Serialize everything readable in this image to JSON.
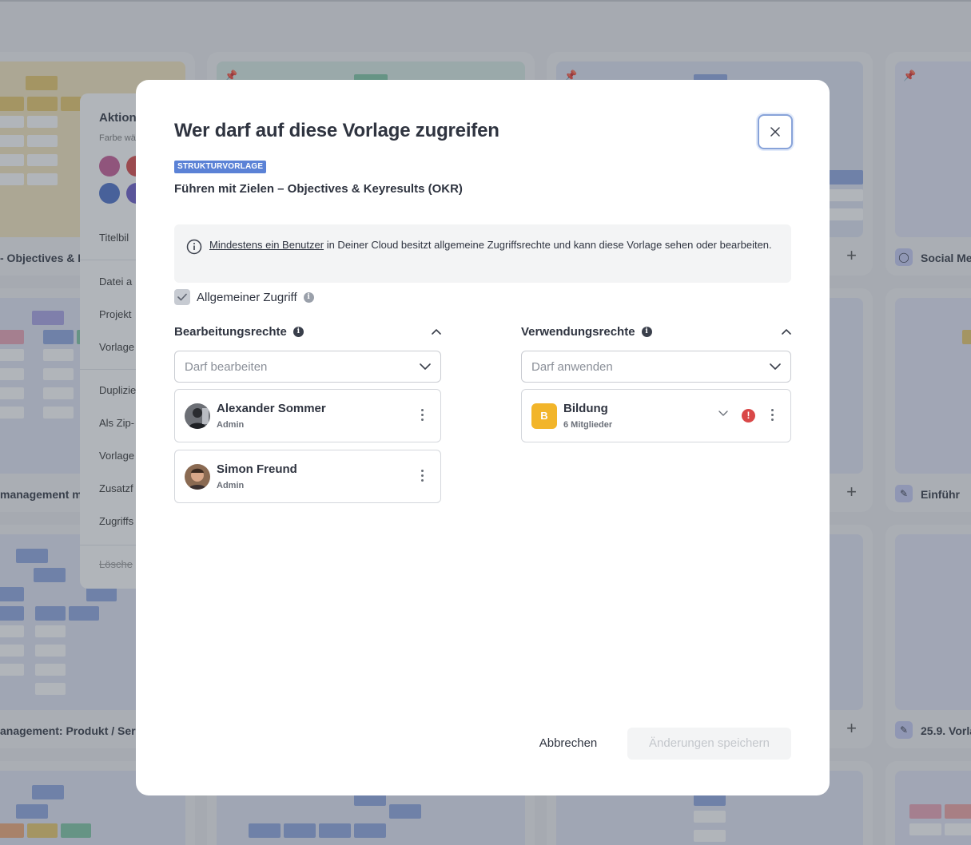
{
  "background": {
    "card_titles": [
      "- Objectives & K",
      "Social Me",
      "management m",
      "Einführ",
      "anagement: Produkt / Ser",
      "25.9. Vorla"
    ],
    "context_menu": {
      "heading": "Aktion",
      "color_label": "Farbe wä",
      "items": [
        "Titelbil",
        "Datei a",
        "Projekt",
        "Vorlage",
        "Duplizie",
        "Als Zip-",
        "Vorlage",
        "Zusatzf",
        "Zugriffs",
        "Lösche"
      ]
    }
  },
  "modal": {
    "title": "Wer darf auf diese Vorlage zugreifen",
    "close_icon": "close-icon",
    "type_tag": "STRUKTURVORLAGE",
    "template_name": "Führen mit Zielen – Objectives & Keyresults (OKR)",
    "info": {
      "link_text": "Mindestens ein Benutzer",
      "text": " in Deiner Cloud besitzt allgemeine Zugriffsrechte und kann diese Vorlage sehen oder bearbeiten."
    },
    "general_access": {
      "label": "Allgemeiner Zugriff",
      "checked": true
    },
    "edit_rights": {
      "heading": "Bearbeitungsrechte",
      "select_placeholder": "Darf bearbeiten",
      "users": [
        {
          "name": "Alexander Sommer",
          "role": "Admin"
        },
        {
          "name": "Simon Freund",
          "role": "Admin"
        }
      ]
    },
    "usage_rights": {
      "heading": "Verwendungsrechte",
      "select_placeholder": "Darf anwenden",
      "groups": [
        {
          "initial": "B",
          "name": "Bildung",
          "members": "6 Mitglieder",
          "color": "#f2b52a",
          "warning": true
        }
      ]
    },
    "buttons": {
      "cancel": "Abbrechen",
      "save": "Änderungen speichern"
    },
    "colors": {
      "accent": "#5b82d6",
      "warning": "#d94848",
      "group_avatar": "#f2b52a"
    }
  }
}
